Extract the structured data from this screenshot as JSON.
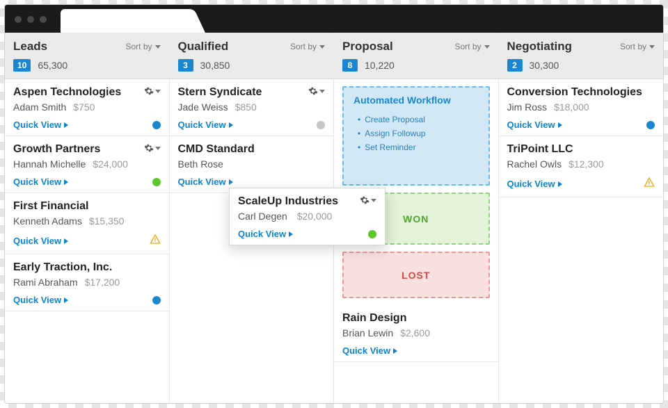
{
  "ui": {
    "sortby_label": "Sort by",
    "quick_view_label": "Quick View"
  },
  "columns": [
    {
      "title": "Leads",
      "count": "10",
      "total": "65,300",
      "cards": [
        {
          "company": "Aspen Technologies",
          "contact": "Adam Smith",
          "value": "$750",
          "status": "blue",
          "gear": true
        },
        {
          "company": "Growth Partners",
          "contact": "Hannah Michelle",
          "value": "$24,000",
          "status": "green",
          "gear": true
        },
        {
          "company": "First Financial",
          "contact": "Kenneth Adams",
          "value": "$15,350",
          "status": "warn",
          "gear": false
        },
        {
          "company": "Early Traction, Inc.",
          "contact": "Rami Abraham",
          "value": "$17,200",
          "status": "blue",
          "gear": false
        }
      ]
    },
    {
      "title": "Qualified",
      "count": "3",
      "total": "30,850",
      "cards": [
        {
          "company": "Stern Syndicate",
          "contact": "Jade Weiss",
          "value": "$850",
          "status": "grey",
          "gear": true
        },
        {
          "company": "CMD Standard",
          "contact": "Beth Rose",
          "value": "",
          "status": "none",
          "gear": false
        }
      ]
    },
    {
      "title": "Proposal",
      "count": "8",
      "total": "10,220",
      "workflow": {
        "title": "Automated Workflow",
        "items": [
          "Create Proposal",
          "Assign Followup",
          "Set Reminder"
        ]
      },
      "won_label": "WON",
      "lost_label": "LOST",
      "cards": [
        {
          "company": "Rain Design",
          "contact": "Brian Lewin",
          "value": "$2,600",
          "status": "none",
          "gear": false
        }
      ]
    },
    {
      "title": "Negotiating",
      "count": "2",
      "total": "30,300",
      "cards": [
        {
          "company": "Conversion Technologies",
          "contact": "Jim Ross",
          "value": "$18,000",
          "status": "blue",
          "gear": false
        },
        {
          "company": "TriPoint LLC",
          "contact": "Rachel Owls",
          "value": "$12,300",
          "status": "warn",
          "gear": false
        }
      ]
    }
  ],
  "floating_card": {
    "company": "ScaleUp Industries",
    "contact": "Carl Degen",
    "value": "$20,000",
    "status": "green"
  }
}
